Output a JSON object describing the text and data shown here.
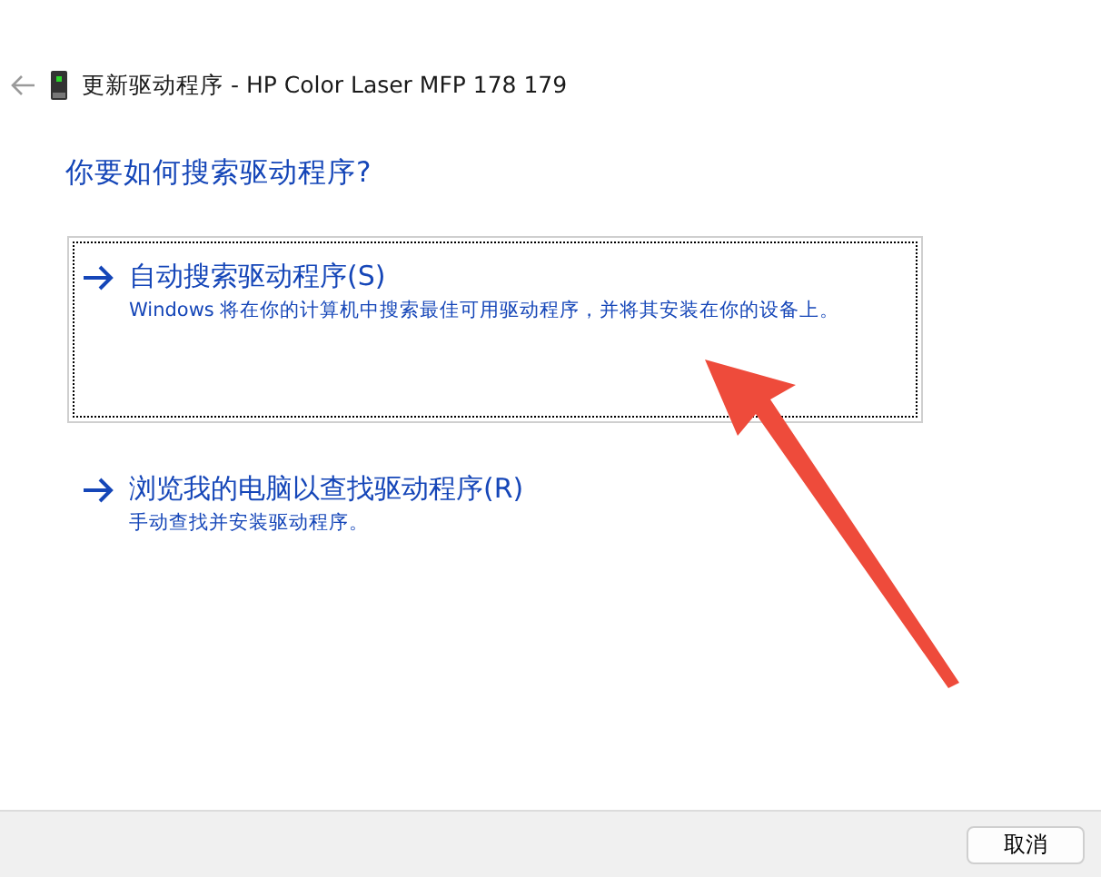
{
  "window": {
    "title": "更新驱动程序 - HP Color Laser MFP 178 179"
  },
  "heading": "你要如何搜索驱动程序?",
  "options": [
    {
      "label": "自动搜索驱动程序(S)",
      "description": "Windows 将在你的计算机中搜索最佳可用驱动程序，并将其安装在你的设备上。",
      "selected": true
    },
    {
      "label": "浏览我的电脑以查找驱动程序(R)",
      "description": "手动查找并安装驱动程序。",
      "selected": false
    }
  ],
  "buttons": [
    "取消"
  ]
}
